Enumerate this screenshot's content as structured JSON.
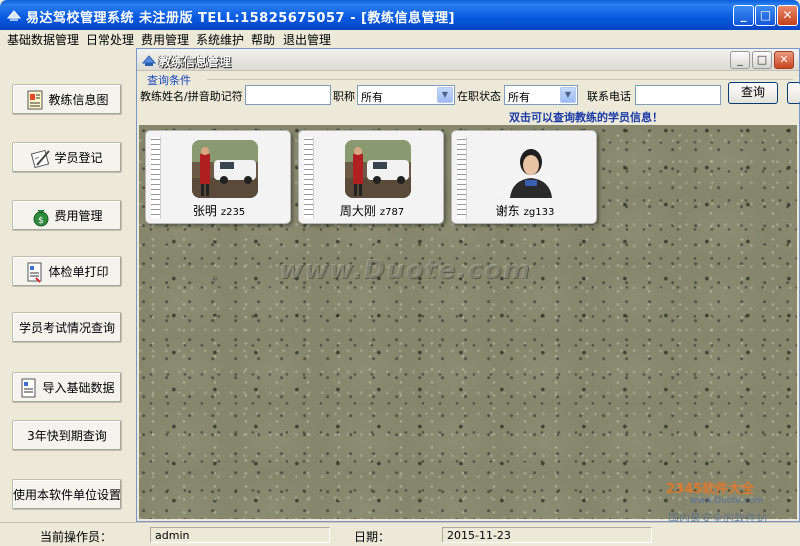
{
  "window": {
    "title": "易达驾校管理系统 未注册版 TELL:15825675057 - [教练信息管理]",
    "minimize": "_",
    "maximize": "□",
    "close": "✕"
  },
  "menu": [
    "基础数据管理",
    "日常处理",
    "费用管理",
    "系统维护",
    "帮助",
    "退出管理"
  ],
  "sidebar": {
    "buttons": [
      {
        "label": "教练信息图",
        "icon": "coach-icon"
      },
      {
        "label": "学员登记",
        "icon": "register-icon"
      },
      {
        "label": "费用管理",
        "icon": "money-bag-icon"
      },
      {
        "label": "体检单打印",
        "icon": "print-form-icon"
      },
      {
        "label": "学员考试情况查询",
        "icon": ""
      },
      {
        "label": "导入基础数据",
        "icon": "import-icon"
      },
      {
        "label": "3年快到期查询",
        "icon": ""
      },
      {
        "label": "使用本软件单位设置",
        "icon": ""
      }
    ]
  },
  "child_window": {
    "title": "教练信息管理",
    "query_group_label": "查询条件",
    "name_label": "教练姓名/拼音助记符",
    "name_value": "",
    "title_label": "职称",
    "title_select": "所有",
    "status_label": "在职状态",
    "status_select": "所有",
    "phone_label": "联系电话",
    "phone_value": "",
    "query_button": "查询",
    "hint": "双击可以查询教练的学员信息！",
    "watermark": "www.Duote.com"
  },
  "coaches": [
    {
      "name": "张明",
      "code": "z235",
      "photo": "car-photo"
    },
    {
      "name": "周大刚",
      "code": "z787",
      "photo": "car-photo"
    },
    {
      "name": "谢东",
      "code": "zg133",
      "photo": "portrait-photo"
    }
  ],
  "status": {
    "operator_label": "当前操作员：",
    "operator": "admin",
    "date_label": "日期：",
    "date": "2015-11-23"
  },
  "overlay": {
    "logo": "2345软件大全",
    "logo_sub": "www.Duote.com",
    "safe": "国内最安全的软件站"
  }
}
